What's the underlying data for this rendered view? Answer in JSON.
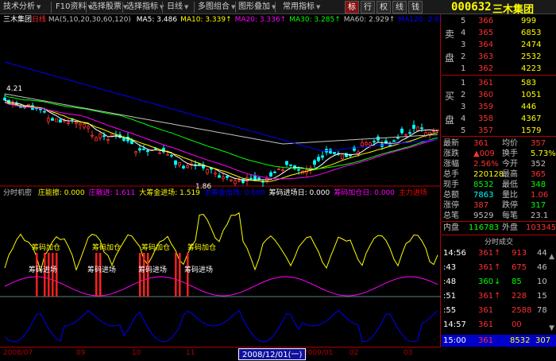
{
  "toolbar": {
    "items": [
      "技术分析",
      "F10资料",
      "选择股票",
      "选择指标",
      "日线",
      "多图组合",
      "图形叠加",
      "常用指标"
    ],
    "tabs": [
      "标",
      "行",
      "权",
      "线",
      "钱"
    ],
    "stock_code": "000632",
    "stock_name": "三木集团"
  },
  "main_legend": {
    "title": "三木集团",
    "period": "日线",
    "params": "MA(5,10,20,30,60,120)",
    "ma": [
      {
        "label": "MA5:",
        "value": "3.486",
        "color": "#ffffff"
      },
      {
        "label": "MA10:",
        "value": "3.339",
        "color": "#ffff00"
      },
      {
        "label": "MA20:",
        "value": "3.336",
        "color": "#ff00ff"
      },
      {
        "label": "MA30:",
        "value": "3.285",
        "color": "#00ff00"
      },
      {
        "label": "MA60:",
        "value": "2.929",
        "color": "#c0c0c0"
      },
      {
        "label": "MA120:",
        "value": "2.676",
        "color": "#0000ff"
      }
    ],
    "high_mark": "4.21",
    "low_mark": "1.86"
  },
  "sub_legend": {
    "name": "分时机密",
    "items": [
      {
        "label": "庄能擦:",
        "value": "0.000",
        "color": "#ffff00"
      },
      {
        "label": "庄散进:",
        "value": "1.611",
        "color": "#ff00ff"
      },
      {
        "label": "大筹金进场:",
        "value": "1.519",
        "color": "#ffff00"
      },
      {
        "label": "主筹金出场:",
        "value": "0.000",
        "color": "#0000ff"
      },
      {
        "label": "筹码进场日:",
        "value": "0.000",
        "color": "#ffffff"
      },
      {
        "label": "筹码加仓日:",
        "value": "0.000",
        "color": "#ff00ff"
      },
      {
        "label": "主力进场",
        "value": "",
        "color": "#ff0000"
      }
    ],
    "signal_add": "筹码加仓",
    "signal_enter": "筹码进场"
  },
  "dates": {
    "ticks": [
      "2008/07",
      "09",
      "10",
      "11",
      "2009/01",
      "02",
      "03"
    ],
    "cursor": "2008/12/01(一)"
  },
  "order_book": {
    "sell_label": [
      "卖",
      "盘"
    ],
    "buy_label": [
      "买",
      "盘"
    ],
    "sell": [
      {
        "level": "5",
        "price": "366",
        "volume": "999"
      },
      {
        "level": "4",
        "price": "365",
        "volume": "6853"
      },
      {
        "level": "3",
        "price": "364",
        "volume": "2474"
      },
      {
        "level": "2",
        "price": "363",
        "volume": "2532"
      },
      {
        "level": "1",
        "price": "362",
        "volume": "4223"
      }
    ],
    "buy": [
      {
        "level": "1",
        "price": "361",
        "volume": "583"
      },
      {
        "level": "2",
        "price": "360",
        "volume": "1051"
      },
      {
        "level": "3",
        "price": "359",
        "volume": "446"
      },
      {
        "level": "4",
        "price": "358",
        "volume": "4367"
      },
      {
        "level": "5",
        "price": "357",
        "volume": "1579"
      }
    ]
  },
  "quote": [
    {
      "l1": "最新",
      "v1": "361",
      "c1": "#ff3030",
      "l2": "均价",
      "v2": "357",
      "c2": "#ff3030"
    },
    {
      "l1": "涨跌",
      "v1": "▲009",
      "c1": "#ff3030",
      "l2": "换手",
      "v2": "5.73%",
      "c2": "#ffff00"
    },
    {
      "l1": "涨幅",
      "v1": "2.56%",
      "c1": "#ff3030",
      "l2": "今开",
      "v2": "352",
      "c2": "#c0c0c0"
    },
    {
      "l1": "总手",
      "v1": "220128",
      "c1": "#ffff00",
      "l2": "最高",
      "v2": "365",
      "c2": "#ff3030"
    },
    {
      "l1": "现手",
      "v1": "8532",
      "c1": "#00ff00",
      "l2": "最低",
      "v2": "348",
      "c2": "#00ff00"
    },
    {
      "l1": "总额",
      "v1": "7863",
      "c1": "#00ffff",
      "l2": "量比",
      "v2": "1.06",
      "c2": "#ff3030"
    },
    {
      "l1": "涨停",
      "v1": "387",
      "c1": "#ff3030",
      "l2": "跌停",
      "v2": "317",
      "c2": "#00ff00"
    },
    {
      "l1": "总笔",
      "v1": "9529",
      "c1": "#c0c0c0",
      "l2": "每笔",
      "v2": "23.1",
      "c2": "#c0c0c0"
    }
  ],
  "inner_outer": {
    "inner_label": "内盘",
    "inner": "116783",
    "outer_label": "外盘",
    "outer": "103345"
  },
  "trades": {
    "title": "分时成交",
    "rows": [
      {
        "time": "14:56",
        "price": "361",
        "dir": "↑",
        "vol": "913",
        "n": "44",
        "pc": "#ff3030",
        "vc": "#ff3030"
      },
      {
        "time": ":43",
        "price": "361",
        "dir": "↑",
        "vol": "675",
        "n": "46",
        "pc": "#ff3030",
        "vc": "#ff3030"
      },
      {
        "time": ":48",
        "price": "360",
        "dir": "↓",
        "vol": "85",
        "n": "10",
        "pc": "#00ff00",
        "vc": "#00ff00"
      },
      {
        "time": ":51",
        "price": "361",
        "dir": "↑",
        "vol": "228",
        "n": "15",
        "pc": "#ff3030",
        "vc": "#ff3030"
      },
      {
        "time": ":55",
        "price": "361",
        "dir": "",
        "vol": "2588",
        "n": "78",
        "pc": "#ff3030",
        "vc": "#ff3030"
      },
      {
        "time": "14:57",
        "price": "361",
        "dir": "",
        "vol": "00",
        "n": "",
        "pc": "#ff3030",
        "vc": "#ff3030"
      }
    ],
    "last": {
      "time": "15:00",
      "price": "361",
      "vol": "8532",
      "n": "307"
    }
  }
}
